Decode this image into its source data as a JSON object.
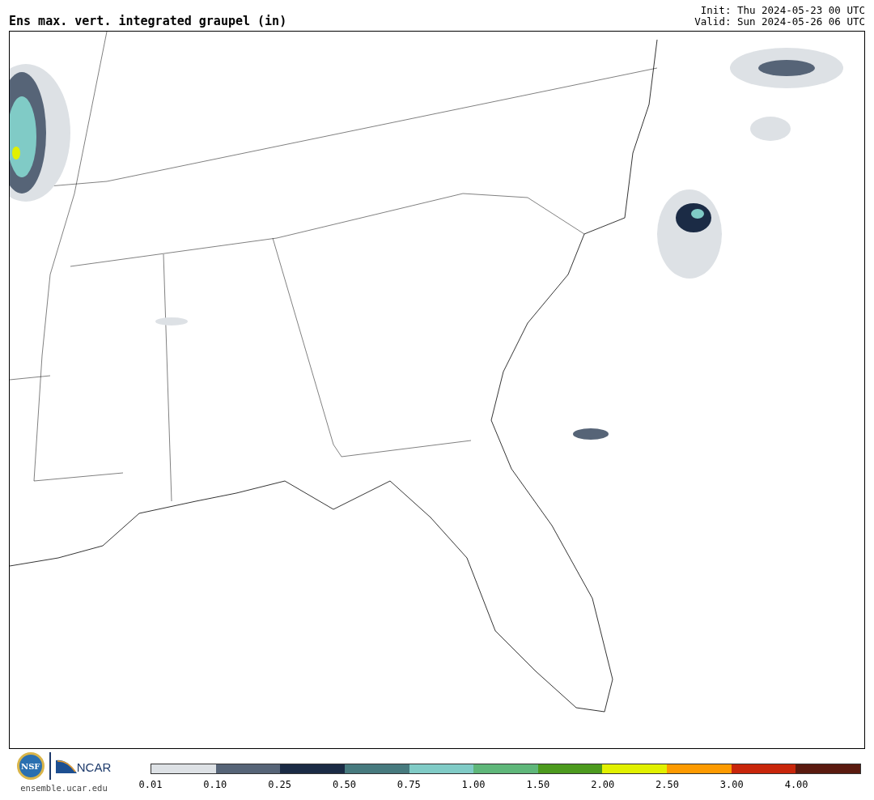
{
  "header": {
    "title": "Ens max. vert. integrated graupel (in)",
    "init": "Init: Thu 2024-05-23 00 UTC",
    "valid": "Valid: Sun 2024-05-26 06 UTC"
  },
  "footer": {
    "nsf_logo": "NSF",
    "ncar_logo": "NCAR",
    "site": "ensemble.ucar.edu"
  },
  "legend": [
    {
      "label": "0.01",
      "color": "#dde1e5"
    },
    {
      "label": "0.10",
      "color": "#566477"
    },
    {
      "label": "0.25",
      "color": "#1b2b45"
    },
    {
      "label": "0.50",
      "color": "#477a7e"
    },
    {
      "label": "0.75",
      "color": "#80cbc6"
    },
    {
      "label": "1.00",
      "color": "#5fb77a"
    },
    {
      "label": "1.50",
      "color": "#4c9a1e"
    },
    {
      "label": "2.00",
      "color": "#e1f000"
    },
    {
      "label": "2.50",
      "color": "#fd9a00"
    },
    {
      "label": "3.00",
      "color": "#c8260b"
    },
    {
      "label": "4.00",
      "color": "#5a1a0f"
    }
  ]
}
